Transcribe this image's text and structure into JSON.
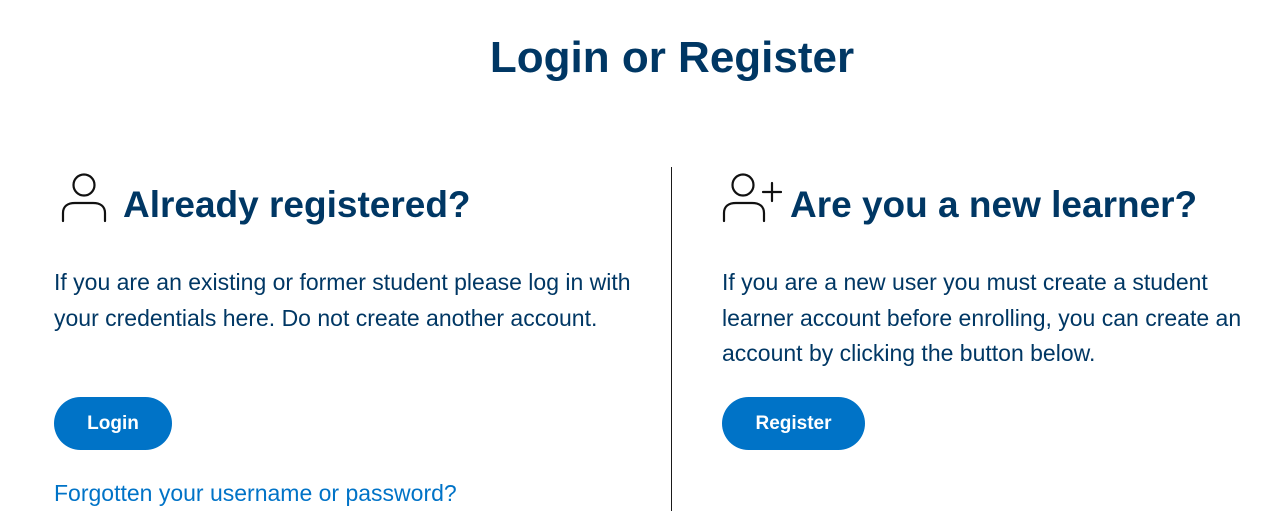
{
  "page": {
    "title": "Login or Register"
  },
  "existing": {
    "heading": "Already registered?",
    "icon": "user-icon",
    "description": "If you are an existing or former student please log in with your credentials here. Do not create another account.",
    "button_label": "Login",
    "forgot_link": "Forgotten your username or password?"
  },
  "new_learner": {
    "heading": "Are you a new learner?",
    "icon": "user-plus-icon",
    "description": "If you are a new user you must create a student learner account before enrolling, you can create an account by clicking the button below.",
    "button_label": "Register"
  },
  "colors": {
    "heading": "#003764",
    "accent": "#0073c7",
    "button_text": "#ffffff"
  }
}
